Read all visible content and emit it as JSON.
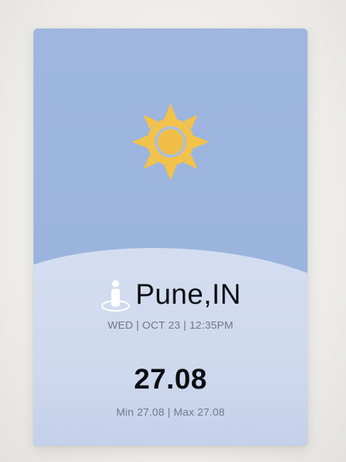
{
  "weather": {
    "condition_icon": "sun-icon",
    "location_icon": "location-pin-icon",
    "city": "Pune,IN",
    "datetime": "WED | OCT 23 | 12:35PM",
    "temperature": "27.08",
    "min_max": "Min 27.08 | Max 27.08"
  },
  "colors": {
    "sky": "#9db5de",
    "ground": "#d3dcef",
    "sun": "#f2c24a"
  }
}
